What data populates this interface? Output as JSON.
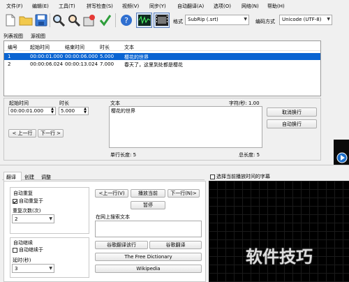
{
  "menu": [
    "文件(F)",
    "编辑(E)",
    "工具(T)",
    "拼写检查(S)",
    "视频(V)",
    "同步(Y)",
    "自动翻译(A)",
    "选项(O)",
    "网络(N)",
    "帮助(H)"
  ],
  "toolbar": {
    "format_label": "格式",
    "format_value": "SubRip (.srt)",
    "encoding_label": "编码方式",
    "encoding_value": "Unicode (UTF-8)"
  },
  "view_tabs": [
    "列表视图",
    "源视图"
  ],
  "grid": {
    "headers": [
      "编号",
      "起始时间",
      "结束时间",
      "时长",
      "文本"
    ],
    "rows": [
      {
        "num": "1",
        "start": "00:00:01.000",
        "end": "00:00:06.000",
        "dur": "5.000",
        "text": "樱花的世界",
        "selected": true
      },
      {
        "num": "2",
        "start": "00:00:06.024",
        "end": "00:00:13.024",
        "dur": "7.000",
        "text": "春天了，这里到处都是樱花",
        "selected": false
      }
    ]
  },
  "editor": {
    "start_label": "起始时间",
    "start_value": "00:00:01.000",
    "duration_label": "时长",
    "duration_value": "5.000",
    "text_label": "文本",
    "cps_label": "字符/秒: 1.00",
    "text_value": "樱花的世界",
    "prev_button": "< 上一行",
    "next_button": "下一行 >",
    "unbreak_button": "取消换行",
    "autobreak_button": "自动换行",
    "single_length": "单行长度: 5",
    "total_length": "总长度: 5"
  },
  "bottom_tabs": [
    "翻译",
    "创建",
    "调整"
  ],
  "translate": {
    "auto_repeat_label": "自动重复",
    "auto_repeat_on_label": "自动重复于",
    "repeat_count_label": "重复次数(次)",
    "repeat_count_value": "2",
    "auto_continue_label": "自动继续",
    "auto_continue_on_label": "自动继续于",
    "delay_label": "延时(秒)",
    "delay_value": "3",
    "prev_button": "<上一行(V)",
    "play_current_button": "播放当前",
    "next_button": "下一行(N)>",
    "pause_button": "暂停",
    "search_online_label": "在网上搜索文本",
    "google_translate_line_button": "谷歌翻译该行",
    "google_translate_button": "谷歌翻译",
    "free_dictionary_button": "The Free Dictionary",
    "wikipedia_button": "Wikipedia"
  },
  "video": {
    "select_current_label": "选择当前播放时间的字幕"
  },
  "watermark": "软件技巧",
  "colors": {
    "selection": "#0a64d2",
    "video_bg": "#000000",
    "accent_blue": "#1e6fc9"
  }
}
